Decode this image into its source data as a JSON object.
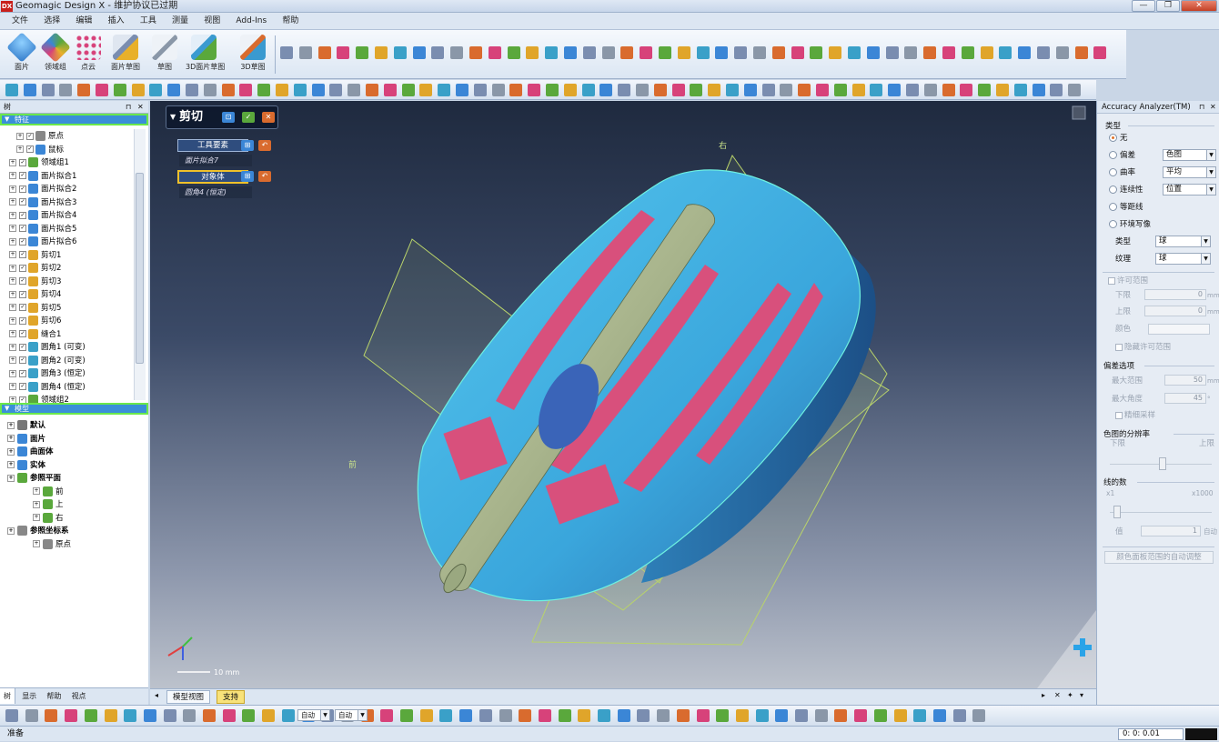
{
  "window": {
    "title": "Geomagic Design X - 维护协议已过期",
    "logo": "DX",
    "minimize": "—",
    "restore": "❐",
    "close": "✕"
  },
  "menubar": [
    "文件",
    "选择",
    "编辑",
    "插入",
    "工具",
    "测量",
    "视图",
    "Add-Ins",
    "帮助"
  ],
  "ribbon": {
    "big_buttons": [
      {
        "label": "面片",
        "icon": "mesh-icon",
        "color": "#3b86d6"
      },
      {
        "label": "领域组",
        "icon": "region-group-icon",
        "color": "#5aa83c"
      },
      {
        "label": "点云",
        "icon": "point-cloud-icon",
        "color": "#d7427a"
      },
      {
        "label": "面片草图",
        "icon": "mesh-sketch-icon",
        "color": "#7a8db0"
      },
      {
        "label": "草图",
        "icon": "sketch-icon",
        "color": "#8a97a8"
      },
      {
        "label": "3D面片草图",
        "icon": "3d-mesh-sketch-icon",
        "color": "#3a9ad0"
      },
      {
        "label": "3D草图",
        "icon": "3d-sketch-icon",
        "color": "#d96b2e"
      }
    ]
  },
  "tree_panel": {
    "title": "树",
    "pin": "⊓",
    "close": "✕",
    "feature_header": "特征",
    "feature_items": [
      {
        "label": "原点",
        "indent": 1,
        "color": "#888888"
      },
      {
        "label": "鼠标",
        "indent": 1,
        "color": "#3b86d6"
      },
      {
        "label": "领域组1",
        "indent": 0,
        "color": "#5aa83c"
      },
      {
        "label": "面片拟合1",
        "indent": 0,
        "color": "#3b86d6"
      },
      {
        "label": "面片拟合2",
        "indent": 0,
        "color": "#3b86d6"
      },
      {
        "label": "面片拟合3",
        "indent": 0,
        "color": "#3b86d6"
      },
      {
        "label": "面片拟合4",
        "indent": 0,
        "color": "#3b86d6"
      },
      {
        "label": "面片拟合5",
        "indent": 0,
        "color": "#3b86d6"
      },
      {
        "label": "面片拟合6",
        "indent": 0,
        "color": "#3b86d6"
      },
      {
        "label": "剪切1",
        "indent": 0,
        "color": "#e0a52a"
      },
      {
        "label": "剪切2",
        "indent": 0,
        "color": "#e0a52a"
      },
      {
        "label": "剪切3",
        "indent": 0,
        "color": "#e0a52a"
      },
      {
        "label": "剪切4",
        "indent": 0,
        "color": "#e0a52a"
      },
      {
        "label": "剪切5",
        "indent": 0,
        "color": "#e0a52a"
      },
      {
        "label": "剪切6",
        "indent": 0,
        "color": "#e0a52a"
      },
      {
        "label": "缝合1",
        "indent": 0,
        "color": "#e0a52a"
      },
      {
        "label": "圆角1 (可变)",
        "indent": 0,
        "color": "#3aa0c8"
      },
      {
        "label": "圆角2 (可变)",
        "indent": 0,
        "color": "#3aa0c8"
      },
      {
        "label": "圆角3 (恒定)",
        "indent": 0,
        "color": "#3aa0c8"
      },
      {
        "label": "圆角4 (恒定)",
        "indent": 0,
        "color": "#3aa0c8"
      },
      {
        "label": "领域组2",
        "indent": 0,
        "color": "#5aa83c"
      }
    ],
    "model_header": "模型",
    "model_items": [
      {
        "label": "默认",
        "indent": 0,
        "bold": true,
        "color": "#777777"
      },
      {
        "label": "面片",
        "indent": 0,
        "bold": true,
        "color": "#3b86d6"
      },
      {
        "label": "曲面体",
        "indent": 0,
        "bold": true,
        "color": "#3b86d6"
      },
      {
        "label": "实体",
        "indent": 0,
        "bold": true,
        "color": "#3b86d6"
      },
      {
        "label": "参照平面",
        "indent": 0,
        "bold": true,
        "color": "#5aa83c"
      },
      {
        "label": "前",
        "indent": 2,
        "bold": false,
        "color": "#5aa83c"
      },
      {
        "label": "上",
        "indent": 2,
        "bold": false,
        "color": "#5aa83c"
      },
      {
        "label": "右",
        "indent": 2,
        "bold": false,
        "color": "#5aa83c"
      },
      {
        "label": "参照坐标系",
        "indent": 0,
        "bold": true,
        "color": "#888888"
      },
      {
        "label": "原点",
        "indent": 2,
        "bold": false,
        "color": "#888888"
      }
    ],
    "tabs": [
      "树",
      "显示",
      "帮助",
      "视点"
    ]
  },
  "cut_panel": {
    "title": "剪切",
    "tool_label": "工具要素",
    "tool_value": "面片拟合7",
    "target_label": "对象体",
    "target_value": "圆角4 (恒定)"
  },
  "viewport": {
    "plane_label_top": "右",
    "plane_label_left": "前",
    "scale_label": "10 mm"
  },
  "view_tabs": [
    "模型视图",
    "支持"
  ],
  "bottom_toolbar": {
    "combo1": "自动",
    "combo2": "自动"
  },
  "status": {
    "text": "准备",
    "coords": "0: 0: 0.01"
  },
  "accuracy": {
    "title": "Accuracy Analyzer(TM)",
    "type_group": "类型",
    "radios": [
      {
        "label": "无",
        "on": true,
        "select": ""
      },
      {
        "label": "偏差",
        "on": false,
        "select": "色图"
      },
      {
        "label": "曲率",
        "on": false,
        "select": "平均"
      },
      {
        "label": "连续性",
        "on": false,
        "select": "位置"
      },
      {
        "label": "等距线",
        "on": false,
        "select": ""
      },
      {
        "label": "环境写像",
        "on": false,
        "select": ""
      }
    ],
    "env_type_label": "类型",
    "env_type_value": "球",
    "texture_label": "纹理",
    "texture_value": "球",
    "tolerance_group": "许可范围",
    "lower_label": "下限",
    "lower_value": "0",
    "upper_label": "上限",
    "upper_value": "0",
    "color_label": "颜色",
    "hide_label": "隐藏许可范围",
    "deviation_group": "偏差选项",
    "max_range_label": "最大范围",
    "max_range_value": "50",
    "max_angle_label": "最大角度",
    "max_angle_value": "45",
    "fine_label": "精细采样",
    "unit_mm": "mm",
    "unit_deg": "°",
    "colormap_group": "色图的分辨率",
    "cm_low": "下限",
    "cm_high": "上限",
    "lines_group": "线的数",
    "lines_min": "x1",
    "lines_max": "x1000",
    "value_label": "值",
    "value_value": "1",
    "auto_label": "自动",
    "auto_adjust": "颜色面板范围的自动调整"
  }
}
